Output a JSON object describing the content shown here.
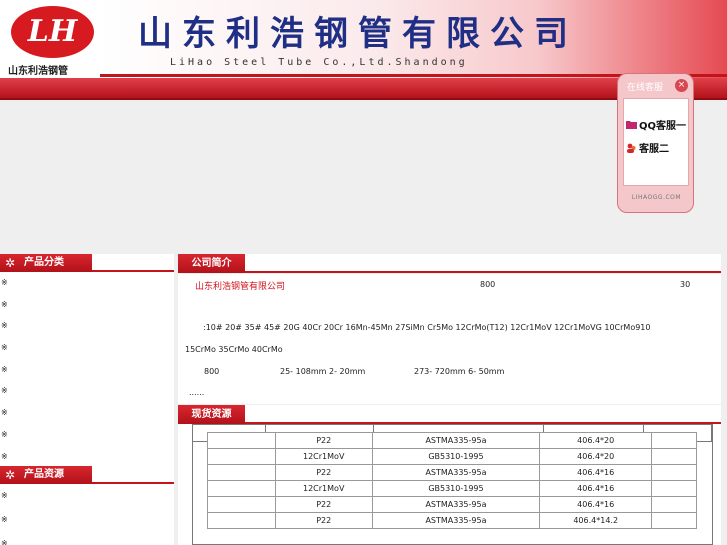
{
  "header": {
    "logo_text": "LH",
    "logo_caption": "山东利浩钢管",
    "company_name": "山东利浩钢管有限公司",
    "company_name_en": "LiHao Steel Tube Co.,Ltd.Shandong"
  },
  "online_service": {
    "title": "在线客服",
    "close_icon": "×",
    "items": [
      "QQ客服一",
      "客服二"
    ],
    "footer": "LIHAOGG.COM"
  },
  "sidebar": {
    "product_category_title": "产品分类",
    "product_category_items": [
      "※",
      "※",
      "※",
      "※",
      "※",
      "※",
      "※",
      "※",
      "※"
    ],
    "product_resource_title": "产品资源",
    "product_resource_items": [
      "※",
      "※",
      "※"
    ]
  },
  "company_intro": {
    "title": "公司简介",
    "lead": "山东利浩钢管有限公司",
    "value_800": "800",
    "value_30": "30",
    "materials_line1": ":10# 20# 35# 45# 20G 40Cr 20Cr 16Mn-45Mn 27SiMn Cr5Mo 12CrMo(T12) 12Cr1MoV 12Cr1MoVG 10CrMo910",
    "materials_line2": "15CrMo 35CrMo 40CrMo",
    "spec_800": "800",
    "spec_a": "25- 108mm  2- 20mm",
    "spec_b": "273- 720mm  6- 50mm",
    "ellipsis": "......"
  },
  "stock": {
    "title": "现货资源",
    "rows": [
      [
        "",
        "P22",
        "ASTMA335-95a",
        "406.4*20",
        ""
      ],
      [
        "",
        "12Cr1MoV",
        "GB5310-1995",
        "406.4*20",
        ""
      ],
      [
        "",
        "P22",
        "ASTMA335-95a",
        "406.4*16",
        ""
      ],
      [
        "",
        "12Cr1MoV",
        "GB5310-1995",
        "406.4*16",
        ""
      ],
      [
        "",
        "P22",
        "ASTMA335-95a",
        "406.4*16",
        ""
      ],
      [
        "",
        "P22",
        "ASTMA335-95a",
        "406.4*14.2",
        ""
      ]
    ]
  },
  "colors": {
    "brand_red": "#c3141c",
    "title_blue": "#1f2f86"
  }
}
